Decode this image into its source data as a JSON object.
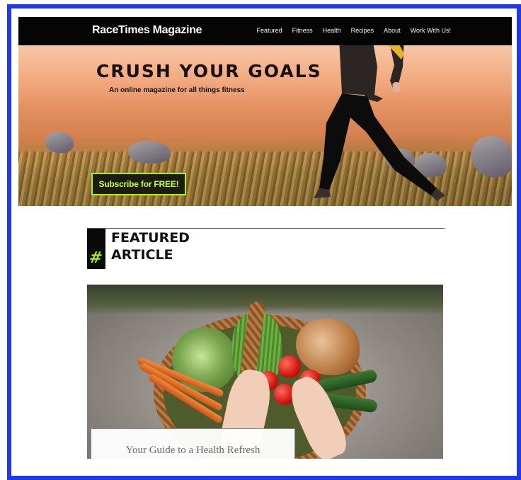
{
  "header": {
    "brand": "RaceTimes Magazine",
    "menu": [
      "Featured",
      "Fitness",
      "Health",
      "Recipes",
      "About",
      "Work With Us!"
    ]
  },
  "hero": {
    "title": "CRUSH YOUR GOALS",
    "subtitle": "An online magazine for all things fitness",
    "cta_label": "Subscribe for FREE!"
  },
  "featured": {
    "hash_symbol": "#",
    "heading_line1": "FEATURED",
    "heading_line2": "ARTICLE",
    "caption": "Your Guide to a Health Refresh"
  },
  "colors": {
    "frame_border": "#1f38e8",
    "nav_bg": "#050505",
    "accent_green": "#b6f000"
  }
}
